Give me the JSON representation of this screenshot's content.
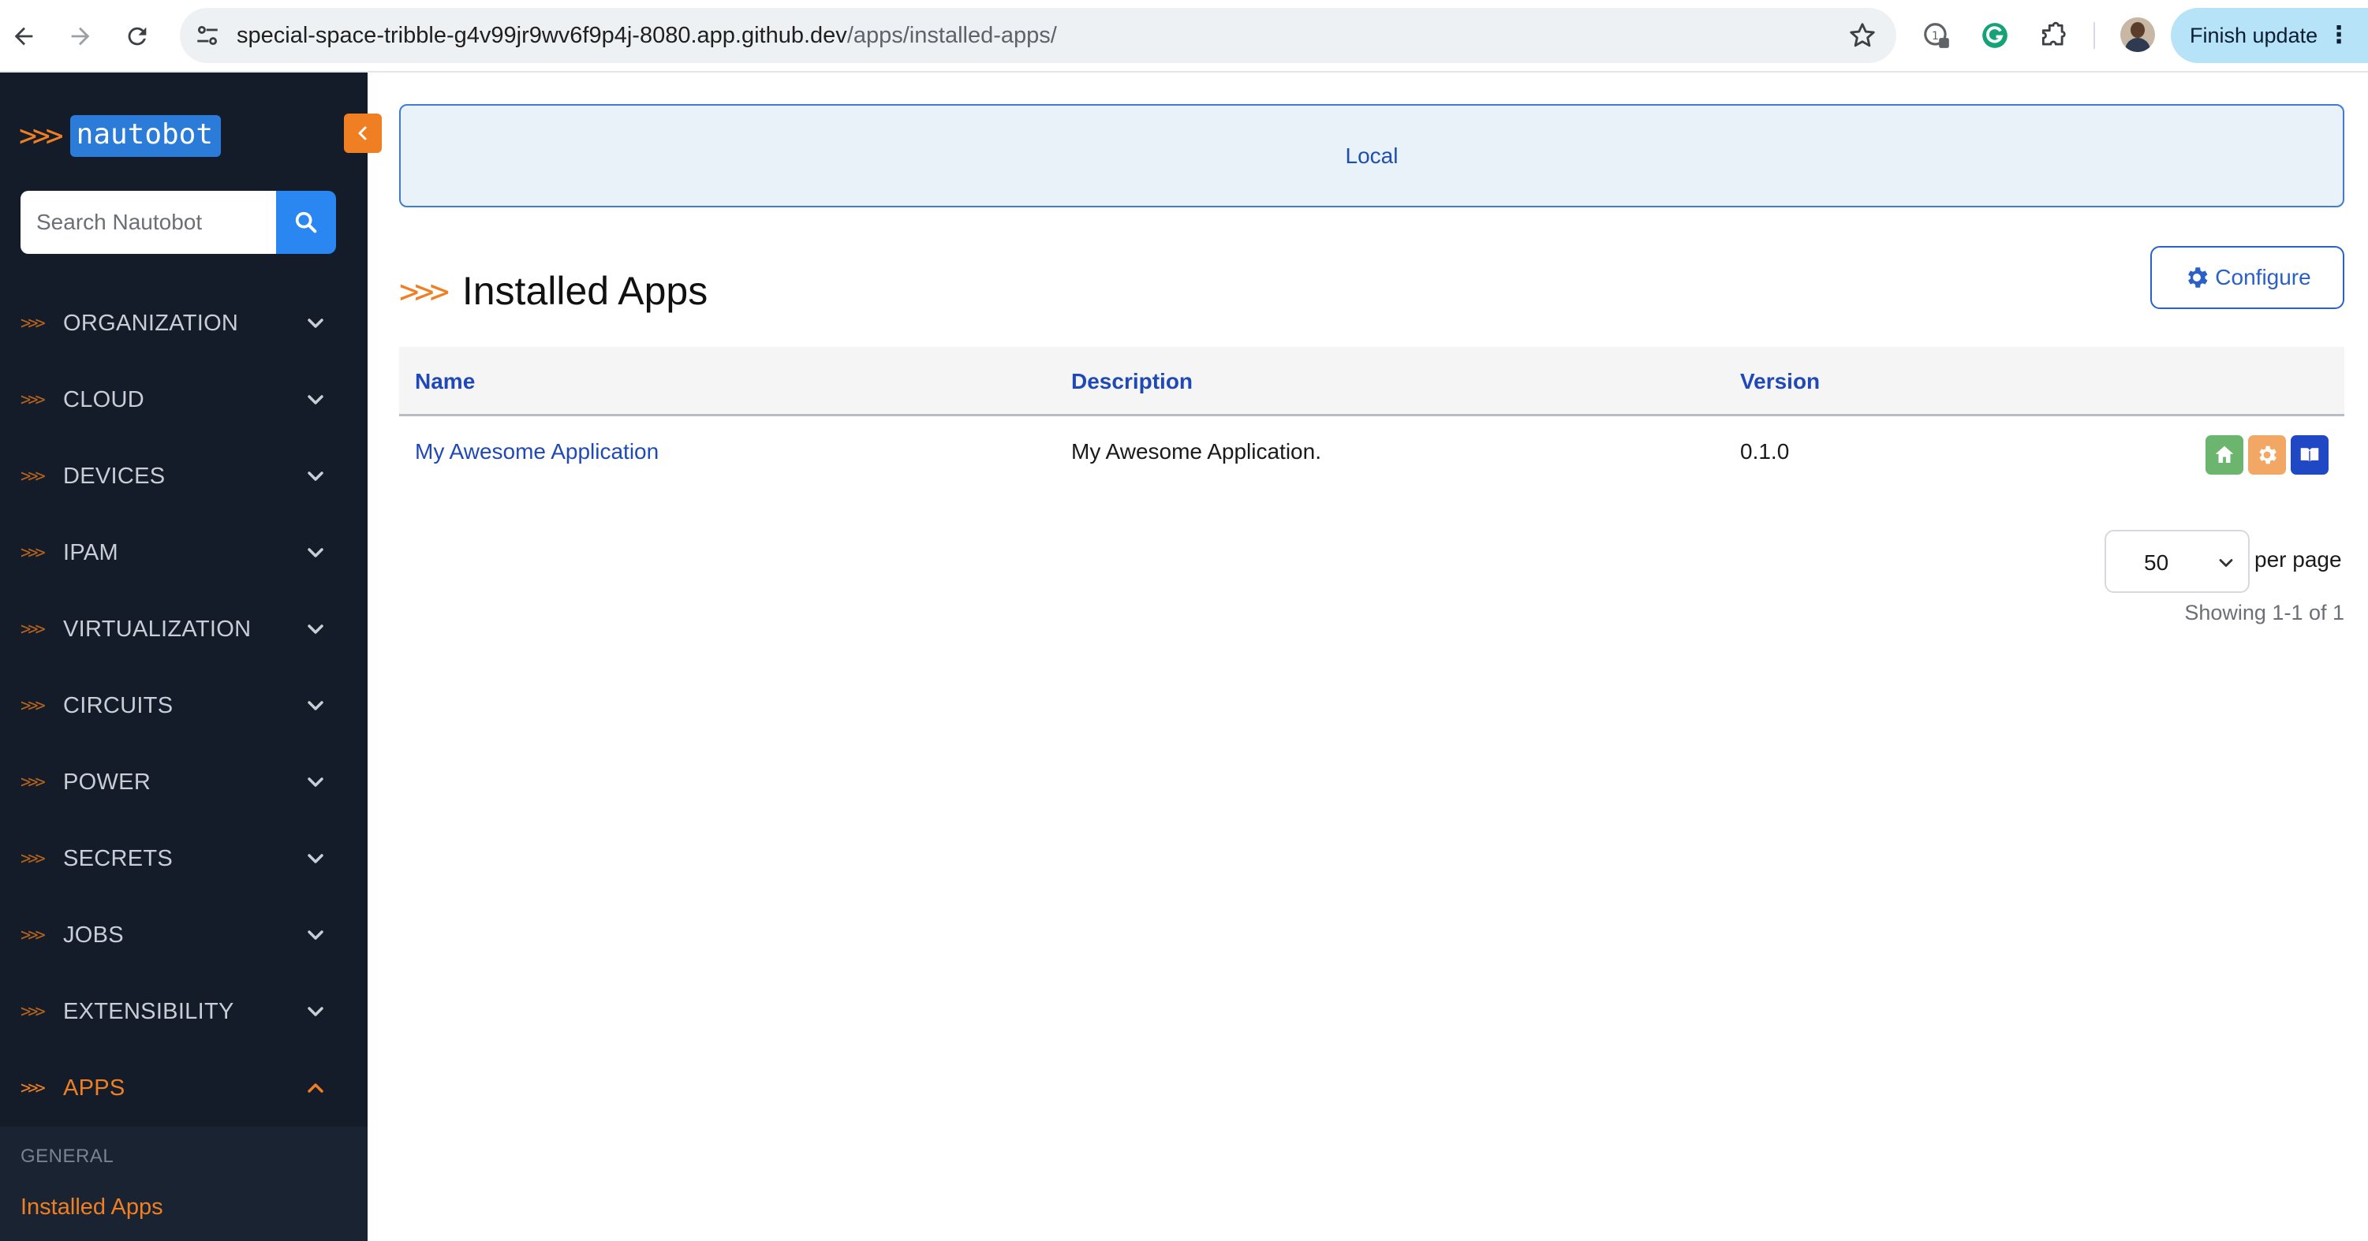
{
  "browser": {
    "url_host": "special-space-tribble-g4v99jr9wv6f9p4j-8080.app.github.dev",
    "url_path": "/apps/installed-apps/",
    "finish_update_label": "Finish update"
  },
  "sidebar": {
    "logo_text": "nautobot",
    "logo_arrows": ">>>",
    "search_placeholder": "Search Nautobot",
    "menu_arrows": ">>>",
    "items": [
      {
        "label": "ORGANIZATION",
        "expanded": false
      },
      {
        "label": "CLOUD",
        "expanded": false
      },
      {
        "label": "DEVICES",
        "expanded": false
      },
      {
        "label": "IPAM",
        "expanded": false
      },
      {
        "label": "VIRTUALIZATION",
        "expanded": false
      },
      {
        "label": "CIRCUITS",
        "expanded": false
      },
      {
        "label": "POWER",
        "expanded": false
      },
      {
        "label": "SECRETS",
        "expanded": false
      },
      {
        "label": "JOBS",
        "expanded": false
      },
      {
        "label": "EXTENSIBILITY",
        "expanded": false
      },
      {
        "label": "APPS",
        "expanded": true
      }
    ],
    "submenu": {
      "heading": "GENERAL",
      "active_item": "Installed Apps"
    }
  },
  "main": {
    "banner_text": "Local",
    "title_arrows": ">>>",
    "page_title": "Installed Apps",
    "configure_label": "Configure",
    "table": {
      "columns": [
        "Name",
        "Description",
        "Version"
      ],
      "rows": [
        {
          "name": "My Awesome Application",
          "description": "My Awesome Application.",
          "version": "0.1.0"
        }
      ]
    },
    "pagination": {
      "per_page_value": "50",
      "per_page_label": "per page",
      "showing_text": "Showing 1-1 of 1"
    }
  },
  "colors": {
    "accent_orange": "#f07f23",
    "sidebar_bg": "#141c2a",
    "link_blue": "#2049b8",
    "banner_border": "#3e7dd1"
  },
  "icons": {
    "row_actions": [
      "home-icon",
      "gear-icon",
      "book-icon"
    ]
  }
}
